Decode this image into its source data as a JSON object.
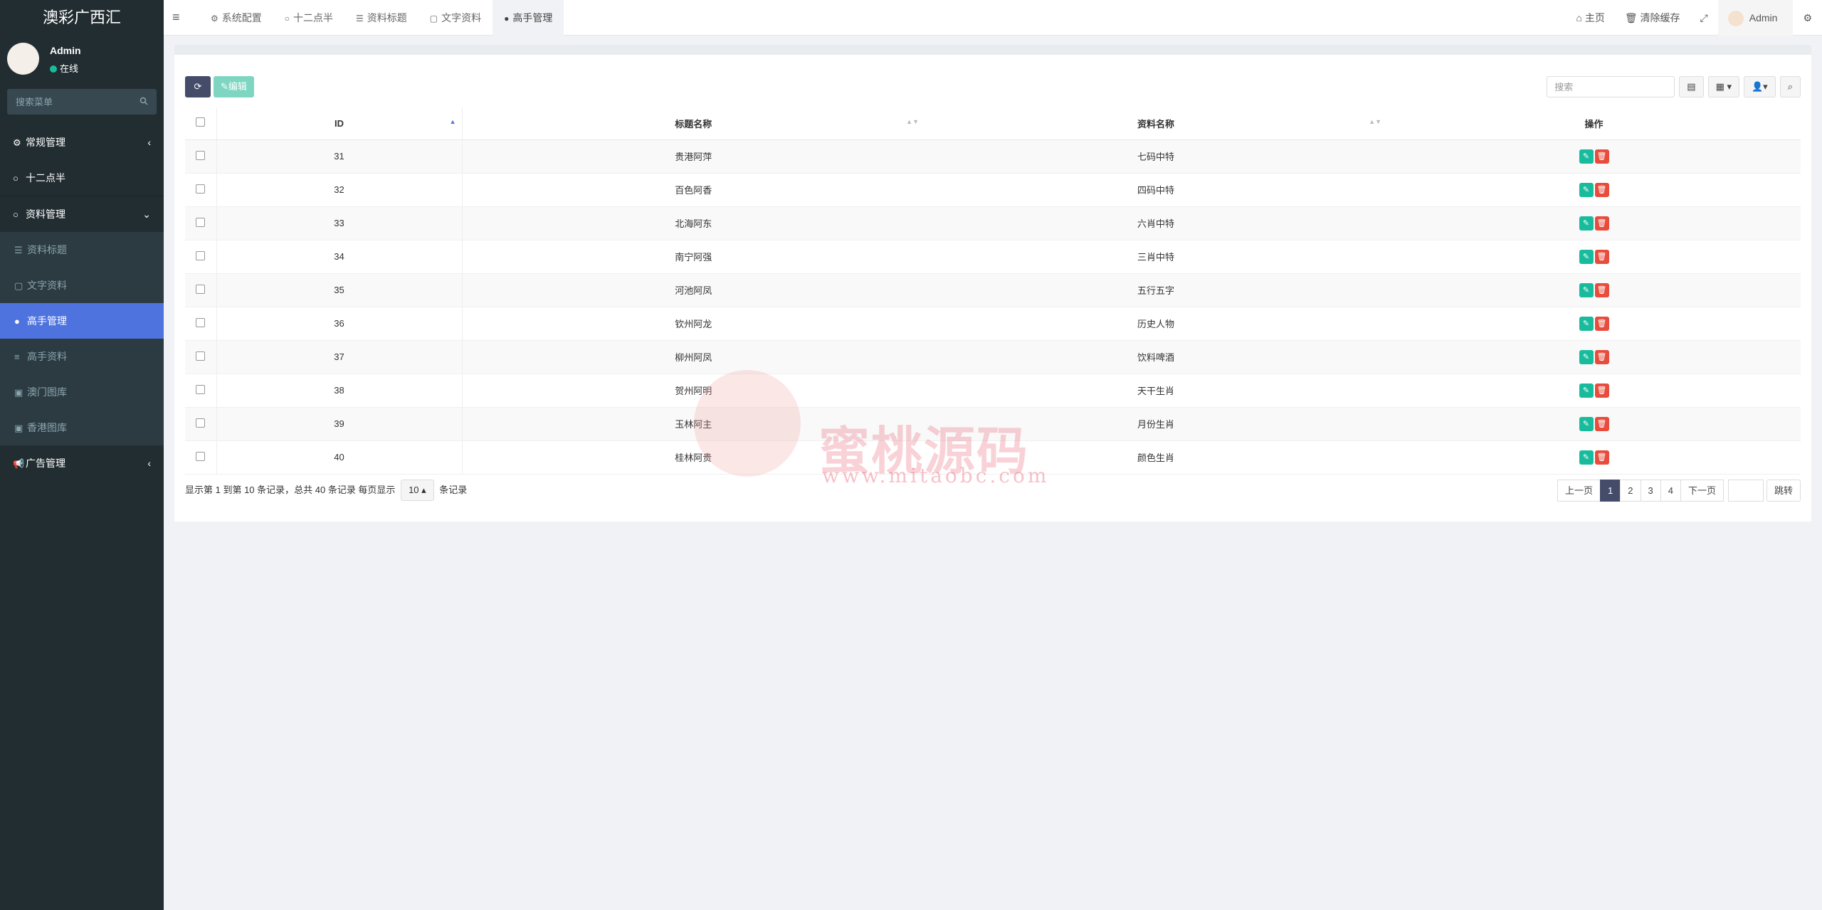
{
  "app": {
    "title": "澳彩广西汇"
  },
  "user": {
    "name": "Admin",
    "status": "在线"
  },
  "sidebar": {
    "search_placeholder": "搜索菜单",
    "items": [
      {
        "label": "常规管理",
        "icon": "gears-icon"
      },
      {
        "label": "十二点半",
        "icon": "circle-icon"
      },
      {
        "label": "资料管理",
        "icon": "circle-icon"
      },
      {
        "label": "资料标题",
        "icon": "list-icon"
      },
      {
        "label": "文字资料",
        "icon": "file-icon"
      },
      {
        "label": "高手管理",
        "icon": "user-icon"
      },
      {
        "label": "高手资料",
        "icon": "database-icon"
      },
      {
        "label": "澳门图库",
        "icon": "image-icon"
      },
      {
        "label": "香港图库",
        "icon": "image-icon"
      },
      {
        "label": "广告管理",
        "icon": "bullhorn-icon"
      }
    ]
  },
  "header": {
    "tabs": [
      {
        "label": "系统配置",
        "icon": "gear-icon"
      },
      {
        "label": "十二点半",
        "icon": "circle-icon"
      },
      {
        "label": "资料标题",
        "icon": "list-icon"
      },
      {
        "label": "文字资料",
        "icon": "file-icon"
      },
      {
        "label": "高手管理",
        "icon": "user-icon"
      }
    ],
    "home": "主页",
    "clear_cache": "清除缓存",
    "admin": "Admin"
  },
  "toolbar": {
    "edit_label": "编辑",
    "search_placeholder": "搜索"
  },
  "table": {
    "columns": [
      "ID",
      "标题名称",
      "资料名称",
      "操作"
    ],
    "rows": [
      {
        "id": "31",
        "title": "贵港阿萍",
        "info": "七码中特"
      },
      {
        "id": "32",
        "title": "百色阿香",
        "info": "四码中特"
      },
      {
        "id": "33",
        "title": "北海阿东",
        "info": "六肖中特"
      },
      {
        "id": "34",
        "title": "南宁阿强",
        "info": "三肖中特"
      },
      {
        "id": "35",
        "title": "河池阿凤",
        "info": "五行五字"
      },
      {
        "id": "36",
        "title": "钦州阿龙",
        "info": "历史人物"
      },
      {
        "id": "37",
        "title": "柳州阿凤",
        "info": "饮料啤酒"
      },
      {
        "id": "38",
        "title": "贺州阿明",
        "info": "天干生肖"
      },
      {
        "id": "39",
        "title": "玉林阿主",
        "info": "月份生肖"
      },
      {
        "id": "40",
        "title": "桂林阿贵",
        "info": "颜色生肖"
      }
    ]
  },
  "footer": {
    "summary": "显示第 1 到第 10 条记录，总共 40 条记录 每页显示",
    "page_size": "10",
    "suffix": "条记录",
    "prev": "上一页",
    "pages": [
      "1",
      "2",
      "3",
      "4"
    ],
    "next": "下一页",
    "go": "跳转"
  },
  "watermark": {
    "text": "蜜桃源码",
    "url": "www.mitaobc.com"
  },
  "colors": {
    "sidebar_bg": "#222d32",
    "accent": "#4e73df",
    "primary_dark": "#444c69",
    "success": "#18bc9c",
    "danger": "#e74c3c"
  }
}
